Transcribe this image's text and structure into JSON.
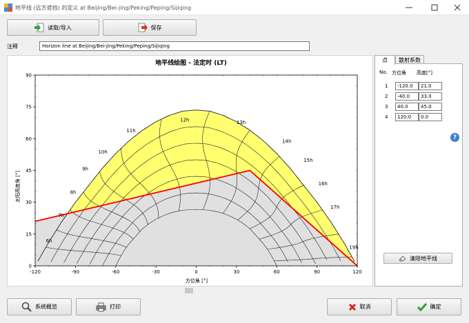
{
  "window": {
    "title": "地平线 (远方遮挡) 的定义 at Beijing/Bei-jing/Peking/Peping/Sijiqing"
  },
  "toolbar": {
    "read_import": "读取/导入",
    "save": "保存"
  },
  "comment": {
    "label": "注释",
    "value": "Horizon line at Beijing/Bei-jing/Peking/Peping/Sijiqing"
  },
  "tabs": [
    "点",
    "散射系数"
  ],
  "points_table": {
    "headers": [
      "No.",
      "方位角",
      "高度[°]"
    ],
    "rows": [
      {
        "no": "1",
        "azimuth": "-120.0",
        "height": "21.0"
      },
      {
        "no": "2",
        "azimuth": "-40.0",
        "height": "33.0"
      },
      {
        "no": "3",
        "azimuth": "40.0",
        "height": "45.0"
      },
      {
        "no": "4",
        "azimuth": "120.0",
        "height": "0.0"
      }
    ]
  },
  "clear_button": "清除地平线",
  "footer": {
    "overview": "系统概览",
    "print": "打印",
    "cancel": "取消",
    "ok": "确定"
  },
  "chart_data": {
    "type": "line",
    "title": "地平线绘图 - 法定时 (LT)",
    "xlabel": "方位角 [°]",
    "ylabel": "太阳高度角 [°]",
    "xlim": [
      -120,
      120
    ],
    "ylim": [
      0,
      90
    ],
    "xticks": [
      "-120",
      "-90",
      "-60",
      "-30",
      "0",
      "30",
      "60",
      "90",
      "120"
    ],
    "yticks": [
      "0",
      "15",
      "30",
      "45",
      "60",
      "75",
      "90"
    ],
    "horizon": {
      "x": [
        -120,
        -40,
        40,
        120
      ],
      "y": [
        21,
        33,
        45,
        0
      ],
      "color": "#ff0000"
    },
    "summer_path": {
      "x": [
        -120,
        -110,
        -100,
        -90,
        -80,
        -70,
        -60,
        -50,
        -40,
        -30,
        -20,
        -10,
        0,
        10,
        20,
        30,
        40,
        50,
        60,
        70,
        80,
        90,
        100,
        110,
        118
      ],
      "y": [
        0,
        11,
        21,
        30,
        38,
        46,
        53,
        59,
        64,
        68,
        71,
        73,
        73.5,
        73,
        71,
        68,
        64,
        59,
        53,
        46,
        38,
        30,
        21,
        11,
        2
      ]
    },
    "winter_path": {
      "x": [
        -60,
        -55,
        -50,
        -45,
        -40,
        -35,
        -30,
        -25,
        -20,
        -15,
        -10,
        -5,
        0,
        5,
        10,
        15,
        20,
        25,
        30,
        35,
        40,
        45,
        50,
        55,
        60
      ],
      "y": [
        0,
        6,
        10.5,
        14,
        17.5,
        20,
        22,
        23.5,
        24.8,
        25.6,
        26.2,
        26.5,
        26.6,
        26.5,
        26.2,
        25.6,
        24.8,
        23.5,
        22,
        20,
        17.5,
        14,
        10.5,
        6,
        0
      ]
    },
    "hour_labels": [
      {
        "label": "6h",
        "x": -112,
        "y": 11
      },
      {
        "label": "7h",
        "x": -103,
        "y": 23
      },
      {
        "label": "8h",
        "x": -94,
        "y": 34
      },
      {
        "label": "9h",
        "x": -85,
        "y": 45
      },
      {
        "label": "10h",
        "x": -73,
        "y": 53
      },
      {
        "label": "11h",
        "x": -52,
        "y": 63
      },
      {
        "label": "12h",
        "x": -12,
        "y": 68
      },
      {
        "label": "13h",
        "x": 30,
        "y": 67
      },
      {
        "label": "14h",
        "x": 64,
        "y": 58
      },
      {
        "label": "15h",
        "x": 80,
        "y": 49
      },
      {
        "label": "16h",
        "x": 91,
        "y": 38
      },
      {
        "label": "17h",
        "x": 100,
        "y": 27
      },
      {
        "label": "19h",
        "x": 114,
        "y": 8
      }
    ]
  }
}
